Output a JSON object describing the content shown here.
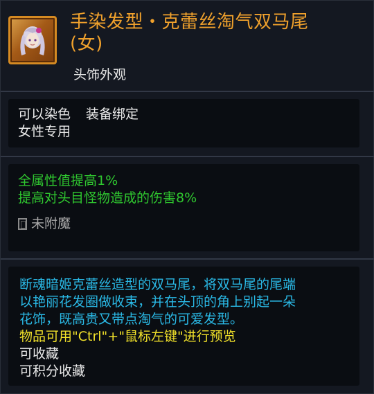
{
  "item": {
    "title": "手染发型・克蕾丝淘气双马尾(女)",
    "type": "头饰外观",
    "icon": "hairstyle-twin-tails-icon",
    "rarity_color": "#f0a12c"
  },
  "attributes": {
    "dyeable": "可以染色",
    "binding": "装备绑定",
    "gender": "女性专用"
  },
  "stats": {
    "line1": "全属性值提高1%",
    "line2": "提高对头目怪物造成的伤害8%",
    "enchant_status": "未附魔"
  },
  "description": {
    "lines": [
      "断魂暗姬克蕾丝造型的双马尾，将双马尾的尾端",
      "以艳丽花发圈做收束，并在头顶的角上别起一朵",
      "花饰，既高贵又带点淘气的可爱发型。"
    ],
    "preview_hint": "物品可用\"Ctrl\"+\"鼠标左键\"进行预览",
    "collectible": "可收藏",
    "points_collectible": "可积分收藏"
  },
  "colors": {
    "title": "#f0a12c",
    "stat": "#2fc72f",
    "description": "#2ab9e6",
    "hint": "#f2e22a"
  }
}
